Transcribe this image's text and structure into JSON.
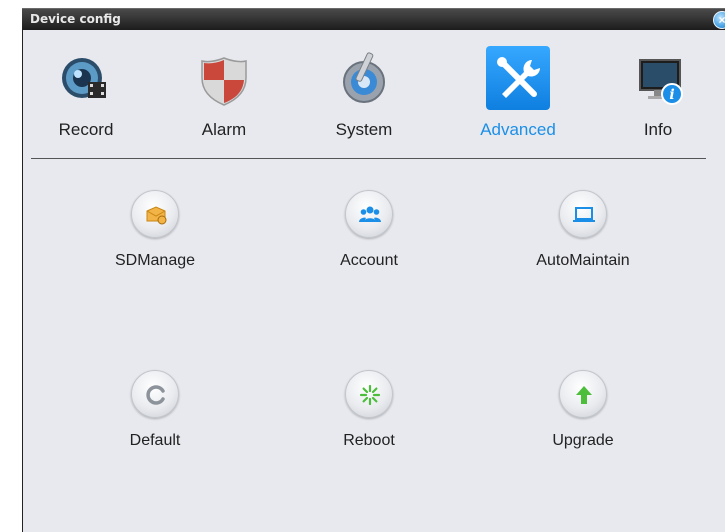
{
  "window": {
    "title": "Device config",
    "close_label": "×"
  },
  "tabs": [
    {
      "label": "Record",
      "icon": "record-icon",
      "active": false
    },
    {
      "label": "Alarm",
      "icon": "alarm-shield-icon",
      "active": false
    },
    {
      "label": "System",
      "icon": "system-gear-icon",
      "active": false
    },
    {
      "label": "Advanced",
      "icon": "tools-icon",
      "active": true
    },
    {
      "label": "Info",
      "icon": "info-monitor-icon",
      "active": false
    }
  ],
  "items": [
    {
      "label": "SDManage",
      "icon": "sd-card-icon"
    },
    {
      "label": "Account",
      "icon": "users-icon"
    },
    {
      "label": "AutoMaintain",
      "icon": "laptop-icon"
    },
    {
      "label": "Default",
      "icon": "refresh-icon"
    },
    {
      "label": "Reboot",
      "icon": "spinner-icon"
    },
    {
      "label": "Upgrade",
      "icon": "arrow-up-icon"
    }
  ],
  "colors": {
    "accent": "#1b8fe8",
    "background": "#e7e9ee",
    "titlebar": "#2a2a2a"
  }
}
